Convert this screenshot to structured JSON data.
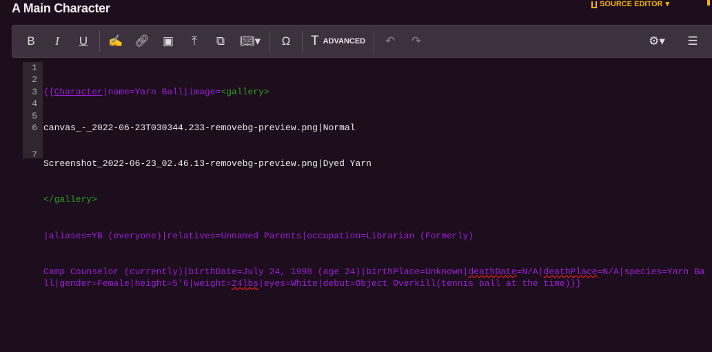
{
  "header": {
    "title": "A Main Character",
    "source_editor": "SOURCE EDITOR"
  },
  "toolbar": {
    "advanced_label": "ADVANCED"
  },
  "editor": {
    "line_numbers": [
      "1",
      "2",
      "3",
      "4",
      "5",
      "6",
      "7"
    ],
    "l1a": "{{",
    "l1b": "Character",
    "l1c": "|name=Yarn Ball|image=",
    "l1d": "<gallery>",
    "l2": "canvas_-_2022-06-23T030344.233-removebg-preview.png|Normal",
    "l3": "Screenshot_2022-06-23_02.46.13-removebg-preview.png|Dyed Yarn",
    "l4": "</gallery>",
    "l5": "|aliases=YB (everyone)|relatives=Unnamed Parents|occupation=Librarian (Formerly)",
    "l6a": "Camp Counselor (currently)|birthDate=July 24, 1998 (age 24)|birthPlace=Unknown|",
    "l6b": "deathDate",
    "l6c": "=N/A|",
    "l6d": "deathPlace",
    "l6e": "=N/A|species=Yarn Ball|gender=Female|height=5'6|weight=",
    "l6f": "24lbs",
    "l6g": "|eyes=White|debut=Object Overkill(tennis ball at the time)}}"
  }
}
